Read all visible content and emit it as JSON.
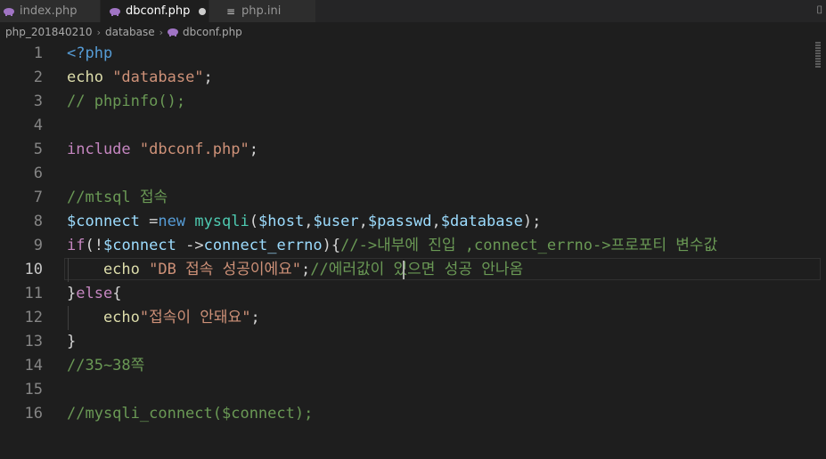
{
  "tabs": [
    {
      "label": "index.php",
      "icon": "php-icon",
      "active": false,
      "dirty": false
    },
    {
      "label": "dbconf.php",
      "icon": "php-icon",
      "active": true,
      "dirty": true
    },
    {
      "label": "php.ini",
      "icon": "ini-file-icon",
      "active": false,
      "dirty": false
    }
  ],
  "breadcrumb": [
    "php_201840210",
    "database",
    "dbconf.php"
  ],
  "current_line": 10,
  "lines": [
    {
      "num": "1",
      "segments": [
        {
          "t": "<?php",
          "c": "t-tag"
        }
      ]
    },
    {
      "num": "2",
      "segments": [
        {
          "t": "echo ",
          "c": "t-fn"
        },
        {
          "t": "\"database\"",
          "c": "t-str"
        },
        {
          "t": ";",
          "c": "t-plain"
        }
      ]
    },
    {
      "num": "3",
      "segments": [
        {
          "t": "// phpinfo();",
          "c": "t-cmt"
        }
      ]
    },
    {
      "num": "4",
      "segments": []
    },
    {
      "num": "5",
      "segments": [
        {
          "t": "include ",
          "c": "t-kw"
        },
        {
          "t": "\"dbconf.php\"",
          "c": "t-str"
        },
        {
          "t": ";",
          "c": "t-plain"
        }
      ]
    },
    {
      "num": "6",
      "segments": []
    },
    {
      "num": "7",
      "segments": [
        {
          "t": "//mtsql 접속",
          "c": "t-cmt"
        }
      ]
    },
    {
      "num": "8",
      "segments": [
        {
          "t": "$connect ",
          "c": "t-var"
        },
        {
          "t": "=",
          "c": "t-plain"
        },
        {
          "t": "new ",
          "c": "t-new"
        },
        {
          "t": "mysqli",
          "c": "t-cls"
        },
        {
          "t": "(",
          "c": "t-plain"
        },
        {
          "t": "$host",
          "c": "t-var"
        },
        {
          "t": ",",
          "c": "t-plain"
        },
        {
          "t": "$user",
          "c": "t-var"
        },
        {
          "t": ",",
          "c": "t-plain"
        },
        {
          "t": "$passwd",
          "c": "t-var"
        },
        {
          "t": ",",
          "c": "t-plain"
        },
        {
          "t": "$database",
          "c": "t-var"
        },
        {
          "t": ");",
          "c": "t-plain"
        }
      ]
    },
    {
      "num": "9",
      "segments": [
        {
          "t": "if",
          "c": "t-kw"
        },
        {
          "t": "(!",
          "c": "t-plain"
        },
        {
          "t": "$connect ",
          "c": "t-var"
        },
        {
          "t": "->",
          "c": "t-plain"
        },
        {
          "t": "connect_errno",
          "c": "t-var"
        },
        {
          "t": "){",
          "c": "t-plain"
        },
        {
          "t": "//->내부에 진입 ,connect_errno->프로포티 변수값",
          "c": "t-cmt"
        }
      ]
    },
    {
      "num": "10",
      "segments": [
        {
          "t": "    echo ",
          "c": "t-fn"
        },
        {
          "t": "\"DB 접속 성공이에요\"",
          "c": "t-str"
        },
        {
          "t": ";",
          "c": "t-plain"
        },
        {
          "t": "//에러값이 있으면 성공 안나옴",
          "c": "t-cmt"
        }
      ]
    },
    {
      "num": "11",
      "segments": [
        {
          "t": "}",
          "c": "t-plain"
        },
        {
          "t": "else",
          "c": "t-kw"
        },
        {
          "t": "{",
          "c": "t-plain"
        }
      ]
    },
    {
      "num": "12",
      "segments": [
        {
          "t": "    echo",
          "c": "t-fn"
        },
        {
          "t": "\"접속이 안돼요\"",
          "c": "t-str"
        },
        {
          "t": ";",
          "c": "t-plain"
        }
      ]
    },
    {
      "num": "13",
      "segments": [
        {
          "t": "}",
          "c": "t-plain"
        }
      ]
    },
    {
      "num": "14",
      "segments": [
        {
          "t": "//35~38쪽",
          "c": "t-cmt"
        }
      ]
    },
    {
      "num": "15",
      "segments": []
    },
    {
      "num": "16",
      "segments": [
        {
          "t": "//mysqli_connect($connect);",
          "c": "t-cmt"
        }
      ]
    }
  ]
}
